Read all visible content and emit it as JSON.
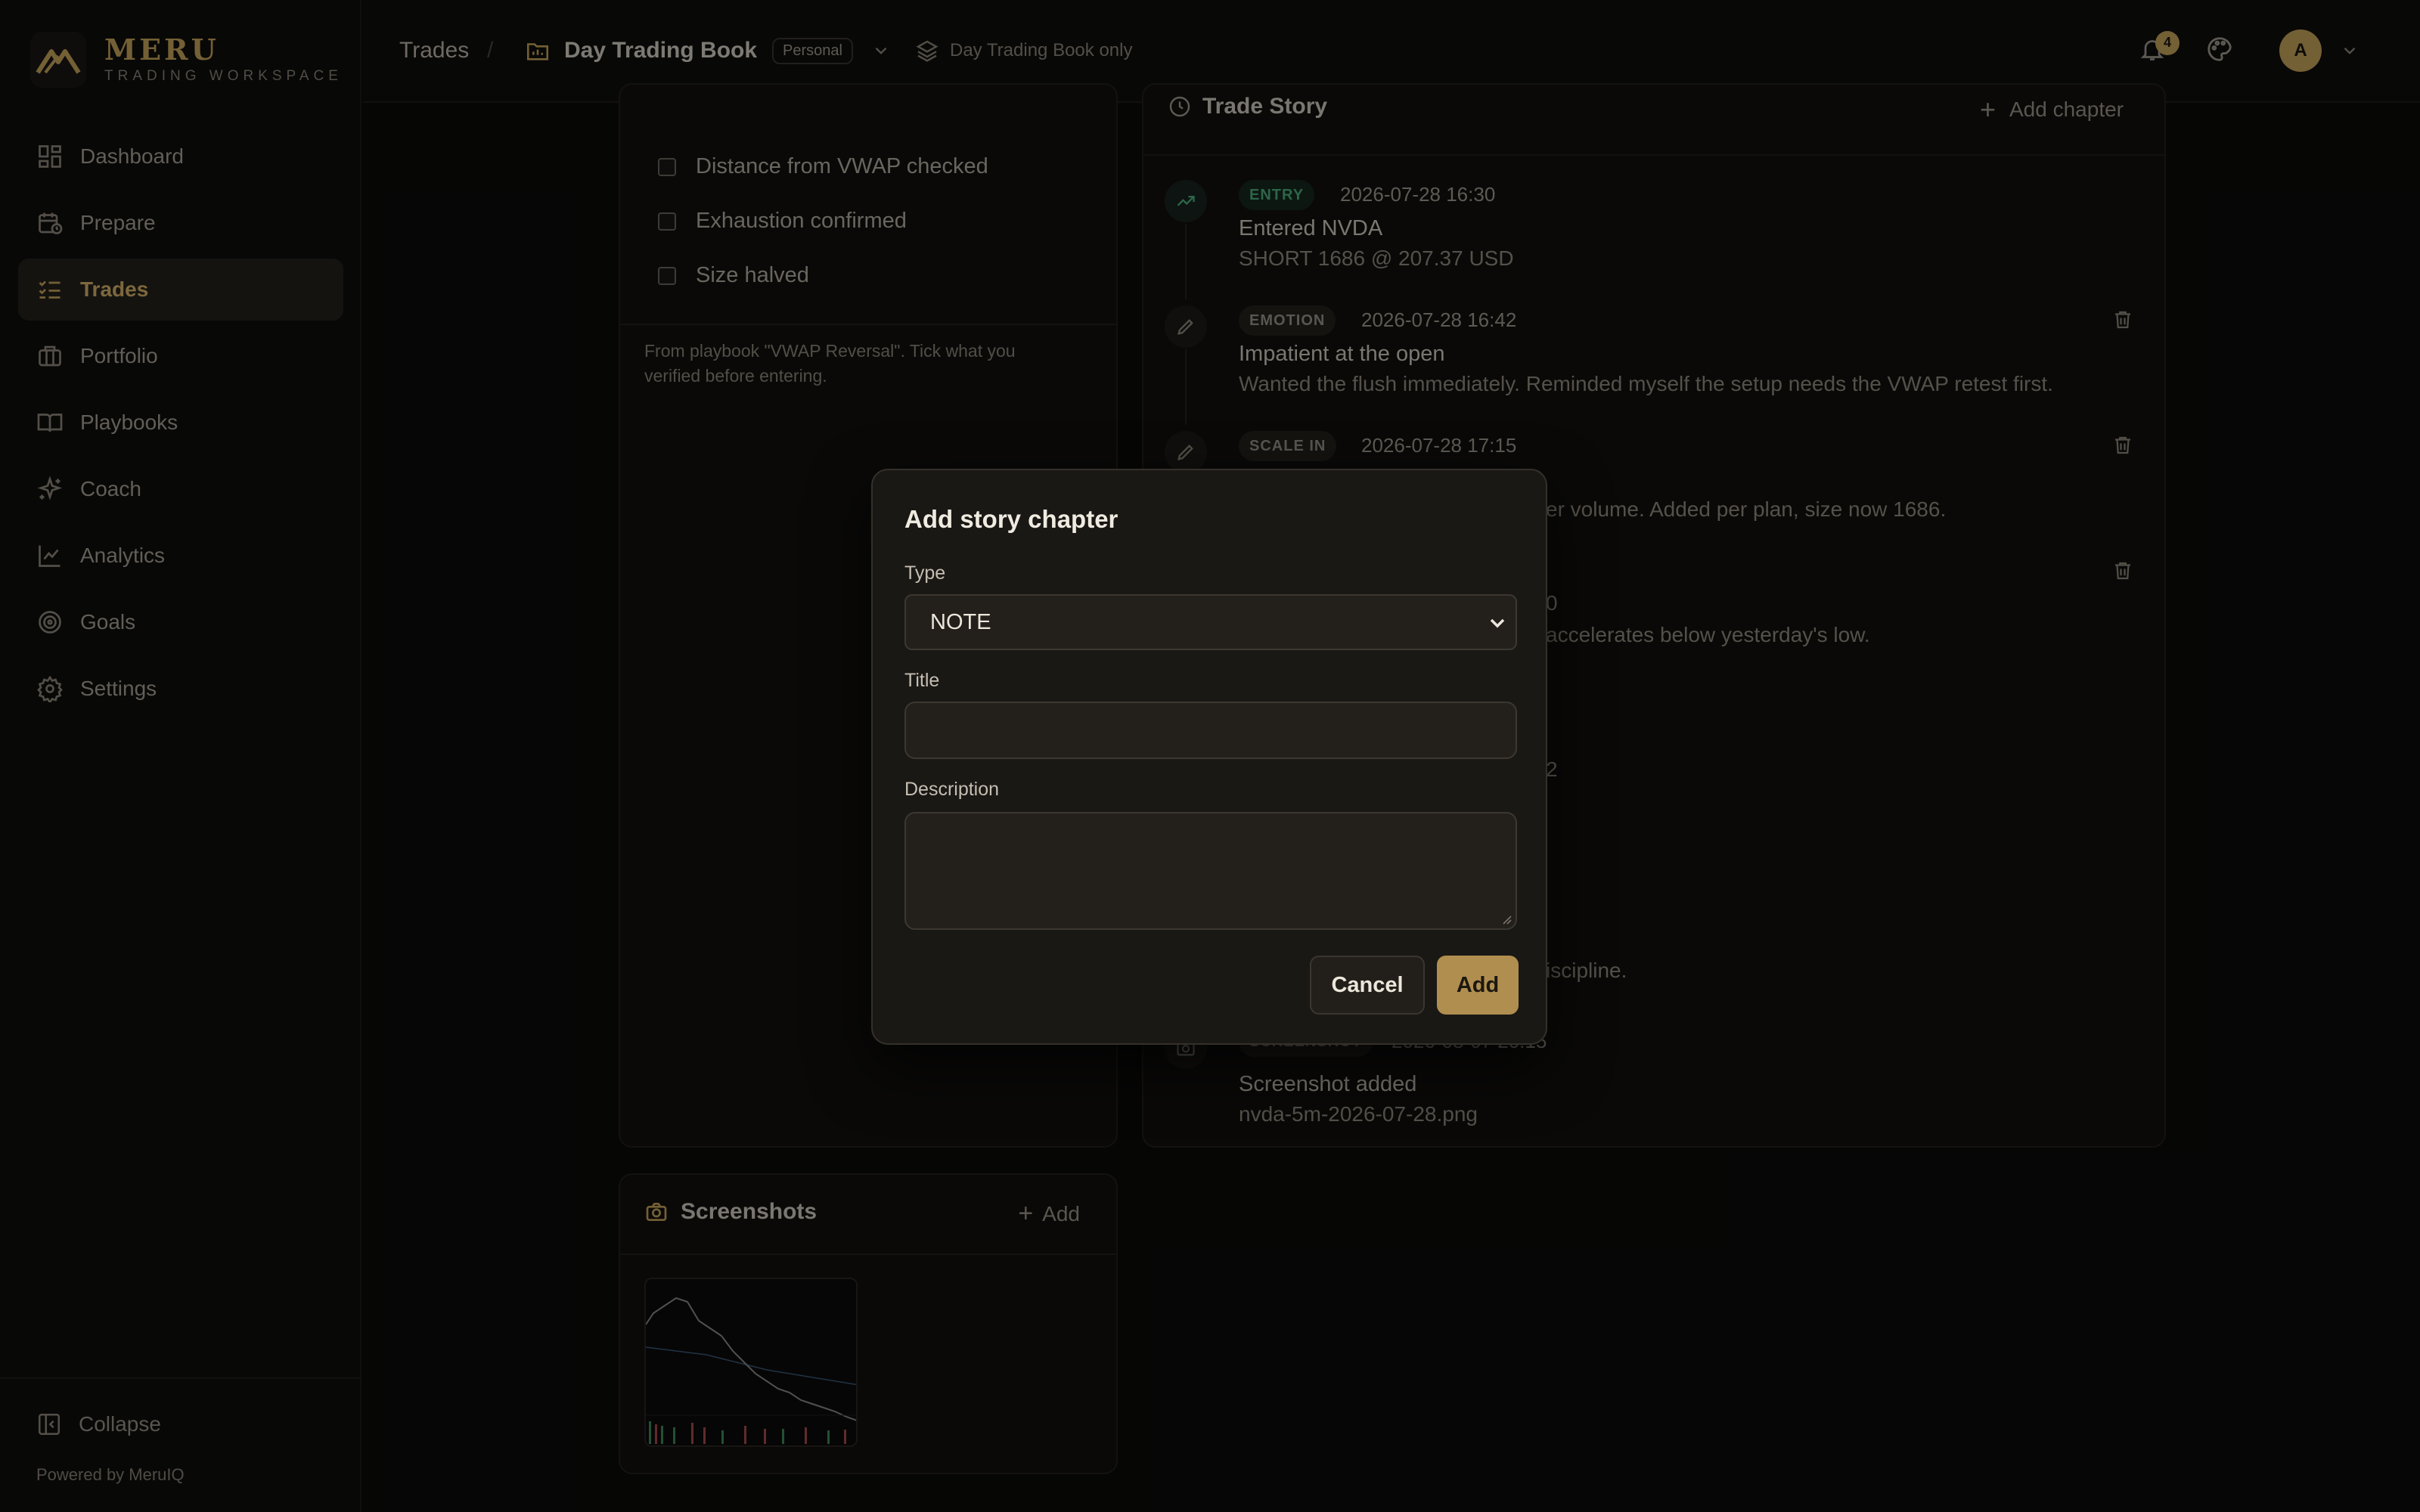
{
  "colors": {
    "accent": "#c9a55c",
    "entry_green": "#4fae7c",
    "background": "#0c0b0a"
  },
  "brand": {
    "name": "MERU",
    "subtitle": "TRADING WORKSPACE"
  },
  "sidebar": {
    "items": [
      {
        "label": "Dashboard",
        "icon": "dashboard-icon"
      },
      {
        "label": "Prepare",
        "icon": "calendar-clock-icon"
      },
      {
        "label": "Trades",
        "icon": "list-checks-icon",
        "active": true
      },
      {
        "label": "Portfolio",
        "icon": "briefcase-icon"
      },
      {
        "label": "Playbooks",
        "icon": "book-open-icon"
      },
      {
        "label": "Coach",
        "icon": "sparkles-icon"
      },
      {
        "label": "Analytics",
        "icon": "line-chart-icon"
      },
      {
        "label": "Goals",
        "icon": "target-icon"
      },
      {
        "label": "Settings",
        "icon": "gear-icon"
      }
    ],
    "collapse_label": "Collapse",
    "powered_by": "Powered by MeruIQ"
  },
  "topbar": {
    "breadcrumb_root": "Trades",
    "breadcrumb_sep": "/",
    "book_name": "Day Trading Book",
    "book_badge": "Personal",
    "scope_label": "Day Trading Book only",
    "notifications_count": "4",
    "avatar_initial": "A"
  },
  "checklist": {
    "items": [
      {
        "label": "Distance from VWAP checked",
        "checked": false
      },
      {
        "label": "Exhaustion confirmed",
        "checked": false
      },
      {
        "label": "Size halved",
        "checked": false
      }
    ],
    "note": "From playbook \"VWAP Reversal\". Tick what you verified before entering."
  },
  "story": {
    "title": "Trade Story",
    "add_label": "Add chapter",
    "events": [
      {
        "tag": "ENTRY",
        "time": "2026-07-28 16:30",
        "title": "Entered NVDA",
        "desc": "SHORT 1686 @ 207.37 USD"
      },
      {
        "tag": "EMOTION",
        "time": "2026-07-28 16:42",
        "title": "Impatient at the open",
        "desc": "Wanted the flush immediately. Reminded myself the setup needs the VWAP retest first."
      },
      {
        "tag": "SCALE IN",
        "time": "2026-07-28 17:15",
        "title": "",
        "desc": "er volume. Added per plan, size now 1686."
      },
      {
        "tag": "",
        "time": "0",
        "title": "",
        "desc": "accelerates below yesterday's low."
      },
      {
        "tag": "",
        "time": "2",
        "title": "",
        "desc": ""
      },
      {
        "tag": "",
        "time": "",
        "title": "",
        "desc": "iscipline."
      },
      {
        "tag": "SCREENSHOT",
        "time": "2026-08-07 20:15",
        "title": "Screenshot added",
        "desc": "nvda-5m-2026-07-28.png"
      }
    ]
  },
  "screenshots": {
    "title": "Screenshots",
    "add_label": "Add"
  },
  "modal": {
    "title": "Add story chapter",
    "type_label": "Type",
    "type_value": "NOTE",
    "title_label": "Title",
    "title_value": "",
    "description_label": "Description",
    "description_value": "",
    "cancel_label": "Cancel",
    "add_label": "Add"
  }
}
